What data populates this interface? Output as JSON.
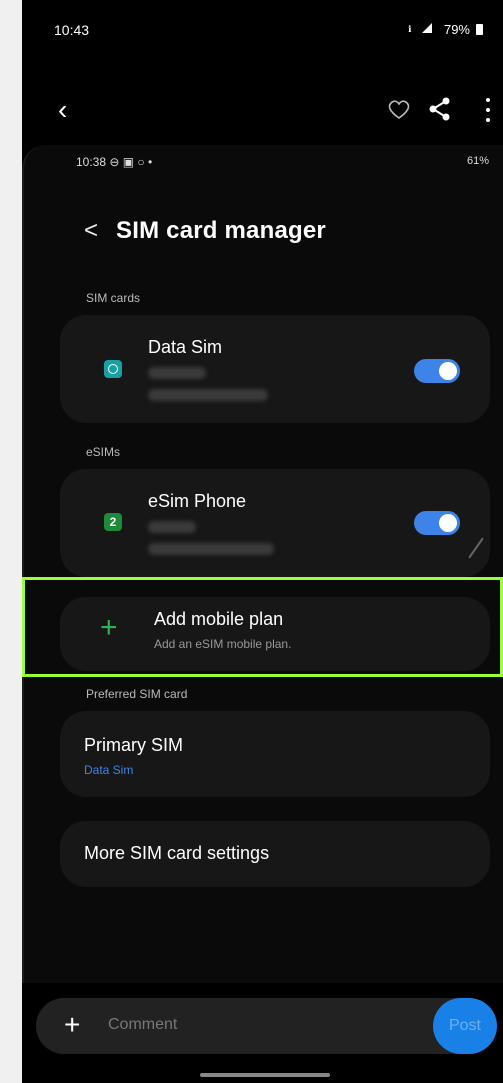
{
  "outer_status": {
    "time": "10:43",
    "signal": "⚡​◢",
    "battery": "79%"
  },
  "inner_status": {
    "time": "10:38",
    "icons_left": "⊖ ▣ ○ •",
    "battery": "61%"
  },
  "header": {
    "title": "SIM card manager"
  },
  "sections": {
    "sim_cards": "SIM cards",
    "esims": "eSIMs",
    "preferred": "Preferred SIM card"
  },
  "sim_cards": [
    {
      "name": "Data Sim",
      "enabled": true
    }
  ],
  "esims": [
    {
      "name": "eSim Phone",
      "badge": "2",
      "enabled": true
    }
  ],
  "add_plan": {
    "title": "Add mobile plan",
    "subtitle": "Add an eSIM mobile plan."
  },
  "primary": {
    "title": "Primary SIM",
    "value": "Data Sim"
  },
  "more_settings": {
    "title": "More SIM card settings"
  },
  "comment": {
    "placeholder": "Comment",
    "post_label": "Post"
  },
  "colors": {
    "accent": "#3e84e8",
    "highlight": "#9aff3a",
    "plus_green": "#2fb35a"
  }
}
